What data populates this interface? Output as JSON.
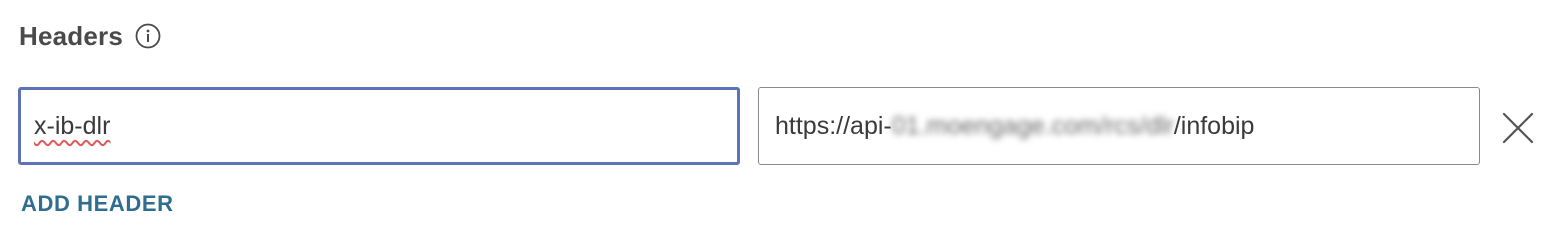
{
  "section": {
    "title": "Headers",
    "info_icon": "info-circle-icon"
  },
  "header_rows": [
    {
      "key": "x-ib-dlr",
      "value_prefix": "https://api-",
      "value_obscured": "01.moengage.com/rcs/dlr",
      "value_suffix": "/infobip",
      "remove_icon": "close-x-icon"
    }
  ],
  "actions": {
    "add_header_label": "ADD HEADER"
  },
  "colors": {
    "title": "#4a4a4a",
    "focus_border": "#5c73b8",
    "input_border": "#8a8a8a",
    "link": "#2f6e8e",
    "spellcheck": "#e05a5a"
  }
}
